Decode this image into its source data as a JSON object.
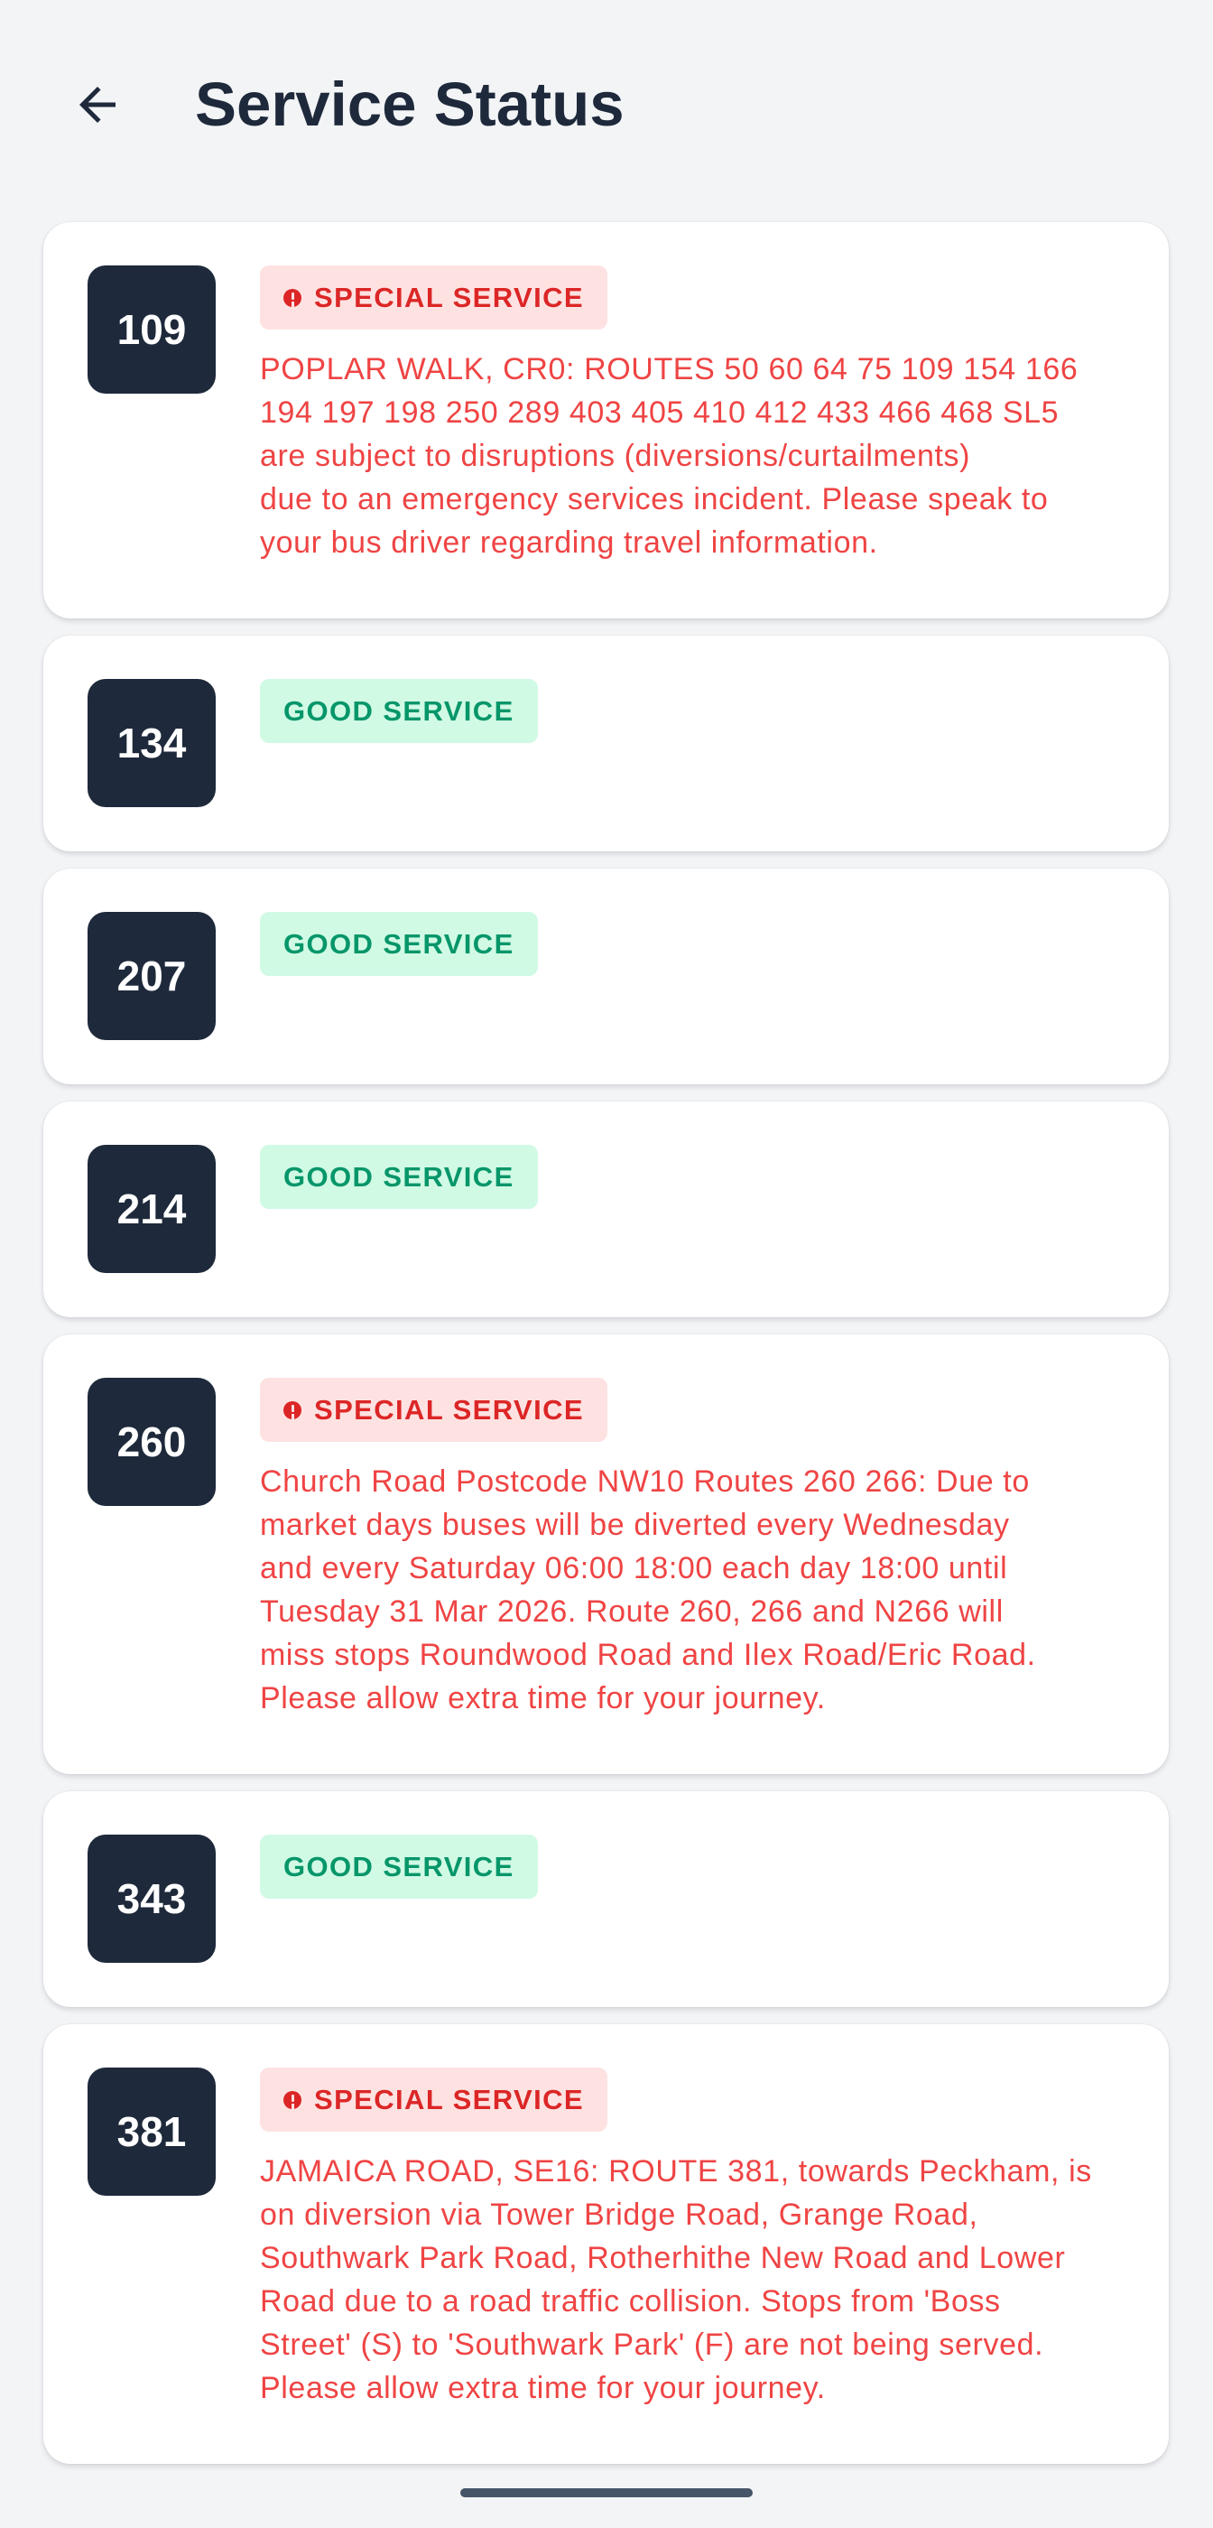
{
  "header": {
    "title": "Service Status",
    "back_icon": "arrow-left-icon"
  },
  "colors": {
    "background": "#f3f4f6",
    "route_badge": "#1e293b",
    "special_text": "#dc2626",
    "special_bg": "#fee2e2",
    "good_text": "#059669",
    "good_bg": "#d1fae5"
  },
  "routes": [
    {
      "number": "109",
      "status": "SPECIAL SERVICE",
      "type": "special",
      "message": "POPLAR WALK, CR0: ROUTES 50 60 64 75 109 154 166\n194 197 198 250 289 403 405 410 412 433 466 468 SL5\nare subject to disruptions (diversions/curtailments)\ndue to an emergency services incident. Please speak to\nyour bus driver regarding travel information."
    },
    {
      "number": "134",
      "status": "GOOD SERVICE",
      "type": "good"
    },
    {
      "number": "207",
      "status": "GOOD SERVICE",
      "type": "good"
    },
    {
      "number": "214",
      "status": "GOOD SERVICE",
      "type": "good"
    },
    {
      "number": "260",
      "status": "SPECIAL SERVICE",
      "type": "special",
      "message": "Church Road Postcode NW10 Routes 260 266: Due to\nmarket days buses will be diverted every Wednesday\nand every Saturday 06:00 18:00 each day 18:00 until\nTuesday 31 Mar 2026. Route 260, 266 and N266 will\nmiss stops Roundwood Road and Ilex Road/Eric Road.\nPlease allow extra time for your journey."
    },
    {
      "number": "343",
      "status": "GOOD SERVICE",
      "type": "good"
    },
    {
      "number": "381",
      "status": "SPECIAL SERVICE",
      "type": "special",
      "message": "JAMAICA ROAD, SE16: ROUTE 381, towards Peckham, is\non diversion via Tower Bridge Road, Grange Road,\nSouthwark Park Road, Rotherhithe New Road and Lower\nRoad due to a road traffic collision. Stops from 'Boss\nStreet' (S) to 'Southwark Park' (F) are not being served.\nPlease allow extra time for your journey."
    }
  ]
}
